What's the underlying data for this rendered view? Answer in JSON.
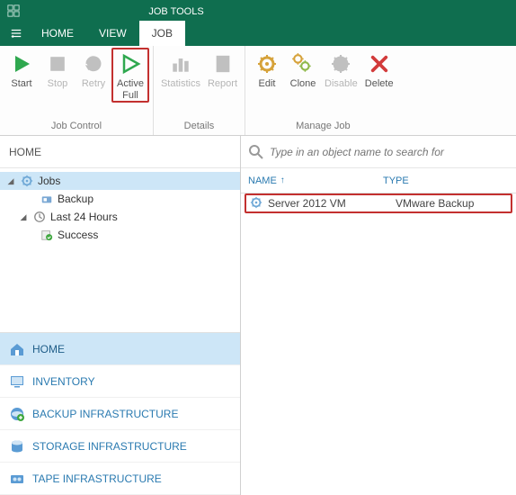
{
  "titlebar": {
    "jobtools_label": "JOB TOOLS"
  },
  "tabs": {
    "home": "HOME",
    "view": "VIEW",
    "job": "JOB"
  },
  "ribbon": {
    "start": "Start",
    "stop": "Stop",
    "retry": "Retry",
    "active_full_line1": "Active",
    "active_full_line2": "Full",
    "statistics": "Statistics",
    "report": "Report",
    "edit": "Edit",
    "clone": "Clone",
    "disable": "Disable",
    "delete": "Delete",
    "group_jobcontrol": "Job Control",
    "group_details": "Details",
    "group_managejob": "Manage Job"
  },
  "breadcrumb": "HOME",
  "tree": {
    "jobs": "Jobs",
    "backup": "Backup",
    "last24": "Last 24 Hours",
    "success": "Success"
  },
  "nav": {
    "home": "HOME",
    "inventory": "INVENTORY",
    "backup_infra": "BACKUP INFRASTRUCTURE",
    "storage_infra": "STORAGE INFRASTRUCTURE",
    "tape_infra": "TAPE INFRASTRUCTURE"
  },
  "search": {
    "placeholder": "Type in an object name to search for"
  },
  "table": {
    "col_name": "NAME",
    "col_type": "TYPE",
    "rows": [
      {
        "name": "Server 2012 VM",
        "type": "VMware Backup"
      }
    ]
  },
  "colors": {
    "brand": "#0f6e4f",
    "accent_blue": "#2a7ab0",
    "highlight_red": "#c3302f",
    "selection": "#cde6f7"
  }
}
